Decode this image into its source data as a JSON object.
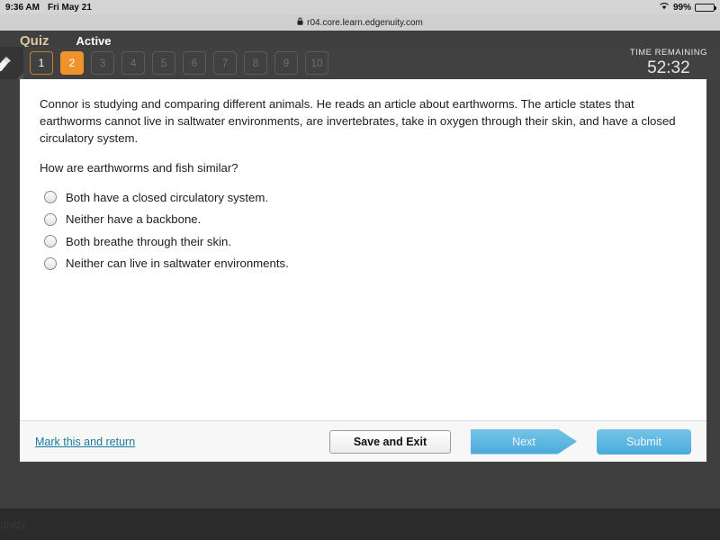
{
  "status_bar": {
    "time": "9:36 AM",
    "date": "Fri May 21",
    "wifi_icon": "wifi-icon",
    "battery_percent": "99%",
    "battery_icon": "battery-icon"
  },
  "browser": {
    "lock_icon": "lock-icon",
    "url": "r04.core.learn.edgenuity.com"
  },
  "header": {
    "title": "Quiz",
    "status": "Active"
  },
  "toolbar": {
    "tool_icon": "highlighter-pencil-icon"
  },
  "question_nav": {
    "items": [
      {
        "number": "1",
        "state": "visited"
      },
      {
        "number": "2",
        "state": "current"
      },
      {
        "number": "3",
        "state": "locked"
      },
      {
        "number": "4",
        "state": "locked"
      },
      {
        "number": "5",
        "state": "locked"
      },
      {
        "number": "6",
        "state": "locked"
      },
      {
        "number": "7",
        "state": "locked"
      },
      {
        "number": "8",
        "state": "locked"
      },
      {
        "number": "9",
        "state": "locked"
      },
      {
        "number": "10",
        "state": "locked"
      }
    ]
  },
  "timer": {
    "label": "TIME REMAINING",
    "value": "52:32"
  },
  "question": {
    "stem": "Connor is studying and comparing different animals. He reads an article about earthworms. The article states that earthworms cannot live in saltwater environments, are invertebrates, take in oxygen through their skin, and have a closed circulatory system.",
    "prompt": "How are earthworms and fish similar?",
    "choices": [
      {
        "label": "Both have a closed circulatory system.",
        "selected": false
      },
      {
        "label": "Neither have a backbone.",
        "selected": false
      },
      {
        "label": "Both breathe through their skin.",
        "selected": false
      },
      {
        "label": "Neither can live in saltwater environments.",
        "selected": false
      }
    ]
  },
  "footer": {
    "mark_link": "Mark this and return",
    "save_label": "Save and Exit",
    "next_label": "Next",
    "submit_label": "Submit"
  },
  "bottom_bar": {
    "text": "ctivity"
  },
  "colors": {
    "accent_orange": "#f0922b",
    "link_blue": "#1b7b9c",
    "button_blue": "#4aaada",
    "title_gold": "#d9c89f"
  }
}
